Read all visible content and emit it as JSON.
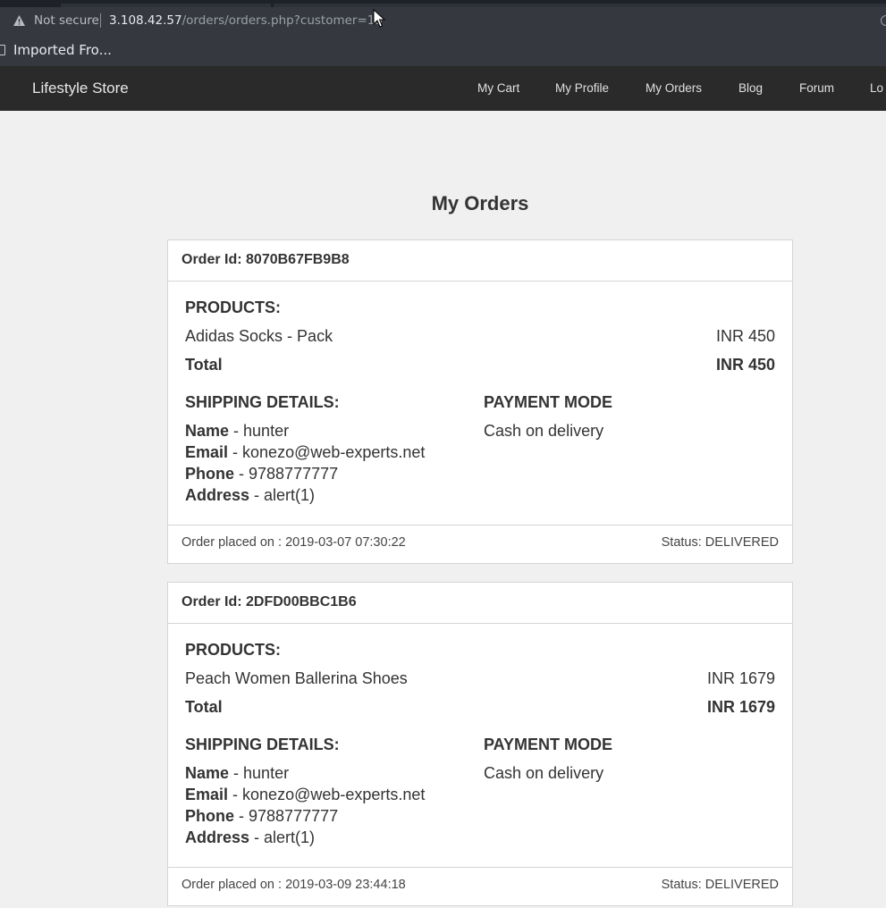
{
  "browser": {
    "not_secure_label": "Not secure",
    "url_host": "3.108.42.57",
    "url_path": "/orders/orders.php?customer=13",
    "bookmark": "Imported Fro..."
  },
  "navbar": {
    "brand": "Lifestyle Store",
    "links": [
      "My Cart",
      "My Profile",
      "My Orders",
      "Blog",
      "Forum",
      "Lo"
    ]
  },
  "page": {
    "title": "My Orders"
  },
  "labels": {
    "order_id": "Order Id:",
    "products": "PRODUCTS:",
    "total": "Total",
    "shipping": "SHIPPING DETAILS:",
    "payment": "PAYMENT MODE",
    "name": "Name",
    "email": "Email",
    "phone": "Phone",
    "address": "Address",
    "placed_on": "Order placed on :",
    "status": "Status:"
  },
  "orders": [
    {
      "id": "8070B67FB9B8",
      "product": "Adidas Socks - Pack",
      "price": "INR 450",
      "total": "INR 450",
      "name": "hunter",
      "email": "konezo@web-experts.net",
      "phone": "9788777777",
      "address": "alert(1)",
      "payment": "Cash on delivery",
      "placed_on": "2019-03-07 07:30:22",
      "status": "DELIVERED"
    },
    {
      "id": "2DFD00BBC1B6",
      "product": "Peach Women Ballerina Shoes",
      "price": "INR 1679",
      "total": "INR 1679",
      "name": "hunter",
      "email": "konezo@web-experts.net",
      "phone": "9788777777",
      "address": "alert(1)",
      "payment": "Cash on delivery",
      "placed_on": "2019-03-09 23:44:18",
      "status": "DELIVERED"
    }
  ]
}
